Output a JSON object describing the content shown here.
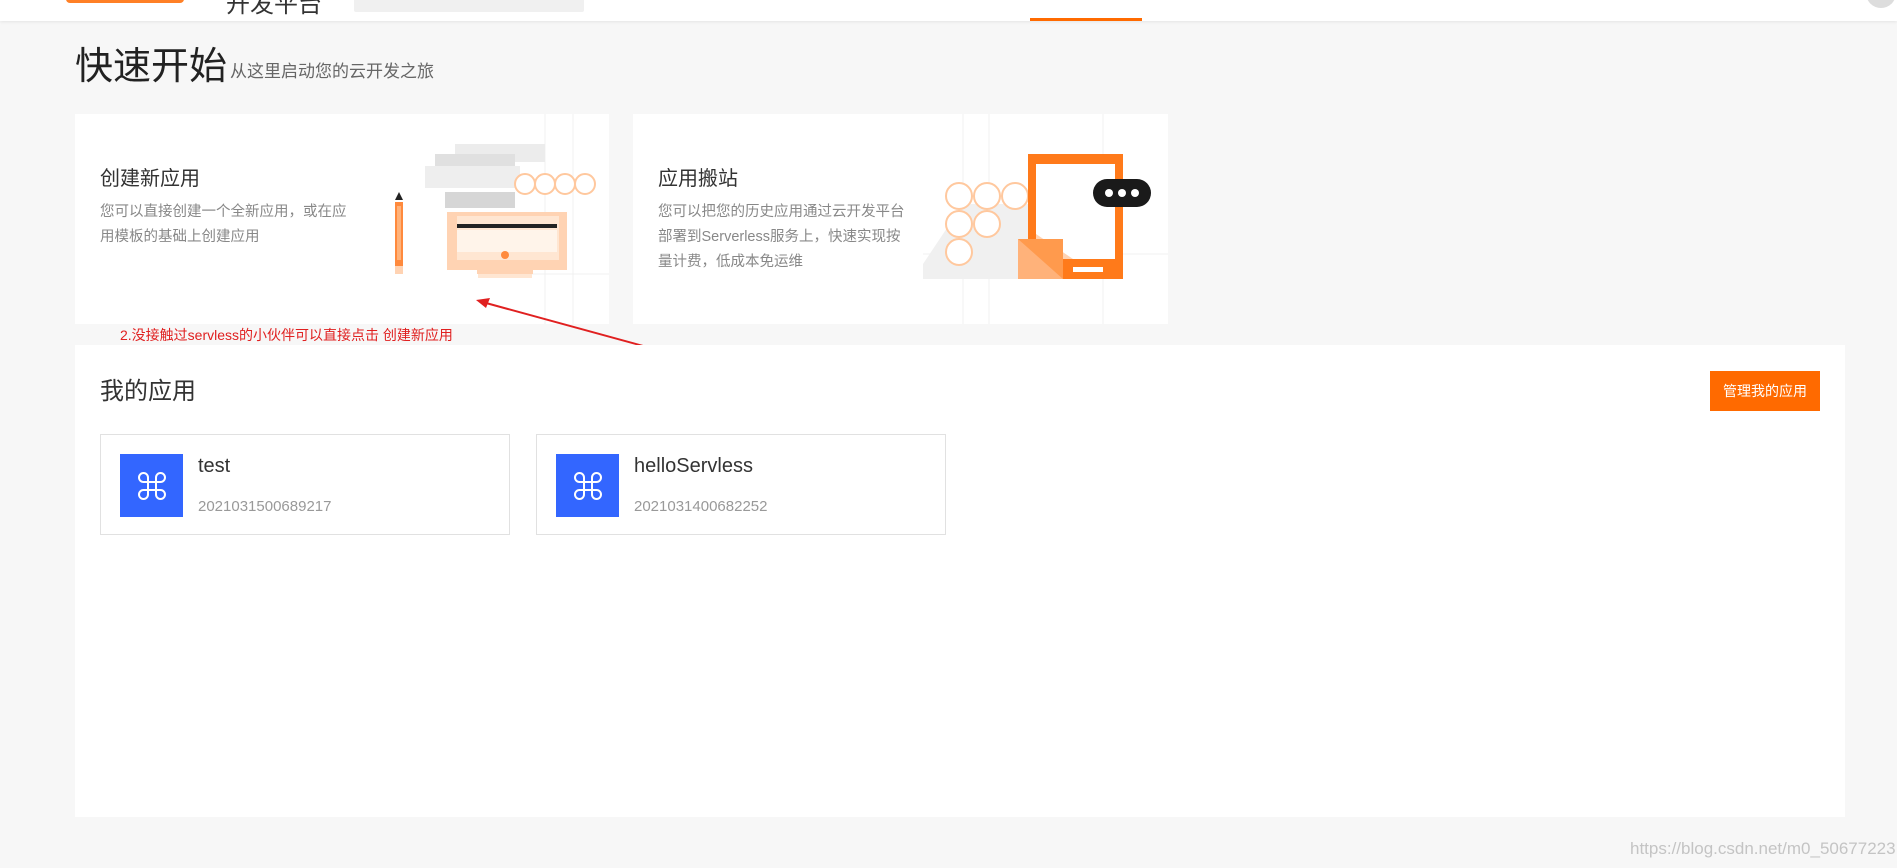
{
  "header": {
    "platform_name": "开发平台"
  },
  "quick_start": {
    "title": "快速开始",
    "subtitle": "从这里启动您的云开发之旅"
  },
  "cards": [
    {
      "title": "创建新应用",
      "description": "您可以直接创建一个全新应用，或在应用模板的基础上创建应用"
    },
    {
      "title": "应用搬站",
      "description": "您可以把您的历史应用通过云开发平台部署到Serverless服务上，快速实现按量计费，低成本免运维"
    }
  ],
  "annotation": {
    "text": "2.没接触过servless的小伙伴可以直接点击 创建新应用",
    "color": "#e02020"
  },
  "my_apps": {
    "title": "我的应用",
    "manage_button": "管理我的应用",
    "apps": [
      {
        "name": "test",
        "id": "2021031500689217",
        "icon": "command-icon"
      },
      {
        "name": "helloServless",
        "id": "2021031400682252",
        "icon": "command-icon"
      }
    ]
  },
  "watermark": "https://blog.csdn.net/m0_50677223",
  "colors": {
    "brand": "#ff6a00",
    "app_icon": "#3366ff"
  }
}
